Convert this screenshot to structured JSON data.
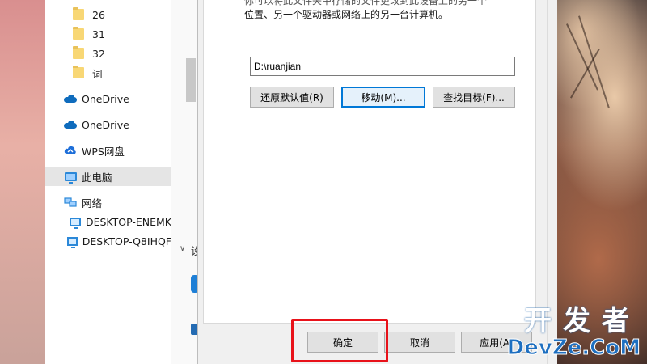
{
  "explorer": {
    "nav_items": [
      {
        "label": "26",
        "icon": "folder-icon"
      },
      {
        "label": "31",
        "icon": "folder-icon"
      },
      {
        "label": "32",
        "icon": "folder-icon"
      },
      {
        "label": "词",
        "icon": "folder-icon"
      },
      {
        "label": "OneDrive",
        "icon": "onedrive-icon"
      },
      {
        "label": "OneDrive",
        "icon": "onedrive-icon"
      },
      {
        "label": "WPS网盘",
        "icon": "wps-cloud-icon"
      },
      {
        "label": "此电脑",
        "icon": "this-pc-icon",
        "selected": true
      },
      {
        "label": "网络",
        "icon": "network-icon"
      },
      {
        "label": "DESKTOP-ENEMK",
        "icon": "computer-icon"
      },
      {
        "label": "DESKTOP-Q8IHQF",
        "icon": "computer-icon"
      }
    ],
    "partial_label": "设"
  },
  "dialog": {
    "description_line1": "你可以将此文件夹中存储的文件更改到此设备上的另一个",
    "description_line2": "位置、另一个驱动器或网络上的另一台计算机。",
    "path_value": "D:\\ruanjian",
    "restore_default_label": "还原默认值(R)",
    "move_label": "移动(M)...",
    "find_target_label": "查找目标(F)...",
    "ok_label": "确定",
    "cancel_label": "取消",
    "apply_label": "应用(A)"
  },
  "watermark": {
    "top": "开发者",
    "bottom": "DevZe.CoM"
  },
  "colors": {
    "highlight": "#e8121a",
    "accent": "#0078d7",
    "watermark_blue": "#1e6fc0"
  }
}
